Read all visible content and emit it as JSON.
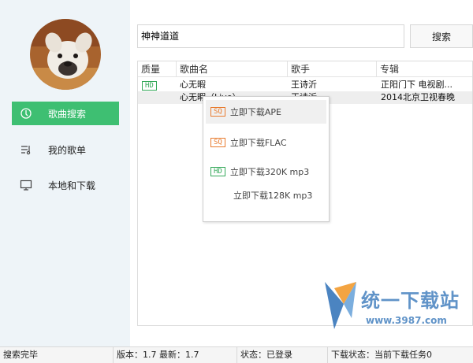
{
  "search": {
    "query": "神神道道",
    "button_label": "搜索"
  },
  "sidebar": {
    "items": [
      {
        "label": "歌曲搜索",
        "icon": "search-icon",
        "active": true
      },
      {
        "label": "我的歌单",
        "icon": "playlist-icon",
        "active": false
      },
      {
        "label": "本地和下载",
        "icon": "monitor-icon",
        "active": false
      }
    ]
  },
  "table": {
    "headers": [
      "质量",
      "歌曲名",
      "歌手",
      "专辑"
    ],
    "rows": [
      {
        "quality": "HD",
        "title": "心无暇",
        "artist": "王诗沂",
        "album": "正阳门下 电视剧..."
      },
      {
        "quality": "",
        "title": "心无暇（Live）",
        "artist": "王诗沂",
        "album": "2014北京卫视春晚"
      }
    ]
  },
  "context_menu": {
    "items": [
      {
        "badge": "SQ",
        "label": "立即下载APE"
      },
      {
        "badge": "SQ",
        "label": "立即下载FLAC"
      },
      {
        "badge": "HD",
        "label": "立即下载320K mp3"
      },
      {
        "badge": "",
        "label": "立即下载128K mp3"
      }
    ]
  },
  "watermark": {
    "brand": "统一下载站",
    "url": "www.3987.com"
  },
  "statusbar": {
    "message": "搜索完毕",
    "version": "版本：1.7 最新：1.7",
    "login": "状态：已登录",
    "download": "下载状态：当前下载任务0"
  },
  "colors": {
    "accent_green": "#3ebf72",
    "hd_green": "#35a95a",
    "sq_orange": "#e87a2d",
    "watermark_orange": "#f29a2e",
    "watermark_blue": "#2b6fb6"
  }
}
